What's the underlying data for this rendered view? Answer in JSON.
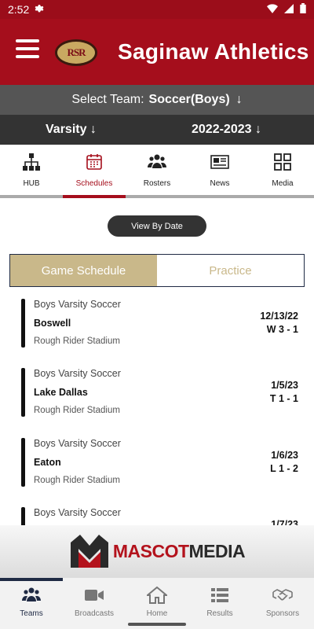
{
  "status": {
    "time": "2:52"
  },
  "header": {
    "title": "Saginaw Athletics",
    "logo_text": "RSR"
  },
  "team_select": {
    "label": "Select Team:",
    "value": "Soccer(Boys)",
    "arrow": "↓"
  },
  "level_select": {
    "level": "Varsity ↓",
    "year": "2022-2023 ↓"
  },
  "tabs": [
    {
      "label": "HUB",
      "icon": "hub-icon"
    },
    {
      "label": "Schedules",
      "icon": "calendar-icon"
    },
    {
      "label": "Rosters",
      "icon": "people-icon"
    },
    {
      "label": "News",
      "icon": "newspaper-icon"
    },
    {
      "label": "Media",
      "icon": "grid-icon"
    }
  ],
  "view_by_date": "View By Date",
  "segment": {
    "game": "Game Schedule",
    "practice": "Practice"
  },
  "games": [
    {
      "level": "Boys Varsity Soccer",
      "opponent": "Boswell",
      "venue": "Rough Rider Stadium",
      "date": "12/13/22",
      "result": "W 3 - 1"
    },
    {
      "level": "Boys Varsity Soccer",
      "opponent": "Lake Dallas",
      "venue": "Rough Rider Stadium",
      "date": "1/5/23",
      "result": "T 1 - 1"
    },
    {
      "level": "Boys Varsity Soccer",
      "opponent": "Eaton",
      "venue": "Rough Rider Stadium",
      "date": "1/6/23",
      "result": "L 1 - 2"
    },
    {
      "level": "Boys Varsity Soccer",
      "opponent": "",
      "venue": "",
      "date": "1/7/23",
      "result": ""
    }
  ],
  "sponsor": {
    "part1": "MASCOT",
    "part2": "MEDIA"
  },
  "bottom_nav": [
    {
      "label": "Teams",
      "icon": "people-icon"
    },
    {
      "label": "Broadcasts",
      "icon": "video-icon"
    },
    {
      "label": "Home",
      "icon": "home-icon"
    },
    {
      "label": "Results",
      "icon": "list-icon"
    },
    {
      "label": "Sponsors",
      "icon": "handshake-icon"
    }
  ],
  "colors": {
    "primary": "#a50e1c",
    "gold": "#c9b88a",
    "navy": "#1f2a44"
  }
}
